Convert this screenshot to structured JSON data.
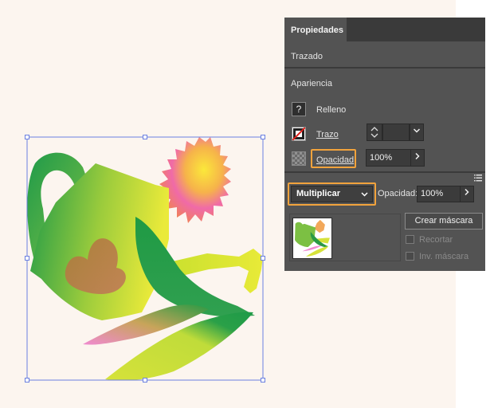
{
  "panel": {
    "tab_label": "Propiedades",
    "section_trazado": "Trazado",
    "section_apariencia": "Apariencia",
    "relleno_label": "Relleno",
    "relleno_icon_glyph": "?",
    "trazo_label": "Trazo",
    "opacidad_label": "Opacidad",
    "opacidad_value": "100%",
    "chevron_right_glyph": "❯",
    "chevron_down_glyph": "⌄"
  },
  "transparency": {
    "blend_mode": "Multiplicar",
    "opacity_label": "Opacidad:",
    "opacity_value": "100%",
    "create_mask_label": "Crear máscara",
    "clip_label": "Recortar",
    "invert_mask_label": "Inv. máscara"
  },
  "colors": {
    "highlight": "#f2a33c",
    "panel_bg": "#535353",
    "panel_dark": "#3a3a3a",
    "canvas_bg": "#fcf5ef",
    "selection": "#6a7fe0"
  },
  "icons": [
    "question-icon",
    "stroke-none-icon",
    "checker-icon",
    "chevron-down-icon",
    "chevron-right-icon",
    "stepper-icon",
    "panel-menu-icon"
  ]
}
